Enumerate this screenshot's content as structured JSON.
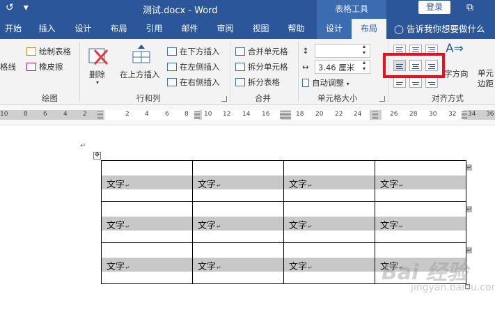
{
  "title_bar": {
    "quick_access": [
      "↺",
      "▾"
    ],
    "document_title": "测试.docx  -  Word",
    "context_tab_title": "表格工具",
    "login_label": "登录",
    "restore_icon": "⧉"
  },
  "tabs": [
    {
      "label": "开始"
    },
    {
      "label": "插入"
    },
    {
      "label": "设计"
    },
    {
      "label": "布局"
    },
    {
      "label": "引用"
    },
    {
      "label": "邮件"
    },
    {
      "label": "审阅"
    },
    {
      "label": "视图"
    },
    {
      "label": "帮助"
    },
    {
      "label": "设计"
    },
    {
      "label": "布局"
    }
  ],
  "tell_me": "告诉我你想要做什么",
  "ribbon": {
    "draw": {
      "partial": "格线",
      "draw_table": "绘制表格",
      "eraser": "橡皮擦",
      "label": "绘图"
    },
    "rows_cols": {
      "delete": "删除",
      "insert_above": "在上方插入",
      "insert_below": "在下方插入",
      "insert_left": "在左侧插入",
      "insert_right": "在右侧插入",
      "label": "行和列"
    },
    "merge": {
      "merge_cells": "合并单元格",
      "split_cells": "拆分单元格",
      "split_table": "拆分表格",
      "label": "合并"
    },
    "cell_size": {
      "height_value": "",
      "width_value": "3.46 厘米",
      "autofit": "自动调整",
      "label": "单元格大小"
    },
    "alignment": {
      "text_direction": "字方向",
      "cell_margins_line1": "单元",
      "cell_margins_line2": "边距",
      "label": "对齐方式"
    }
  },
  "ruler": {
    "left_ticks": [
      "10",
      "8",
      "6",
      "4",
      "2"
    ],
    "right_ticks": [
      "2",
      "4",
      "6",
      "8",
      "10",
      "12",
      "14",
      "16",
      "18",
      "20",
      "22",
      "24",
      "26",
      "28",
      "30",
      "32",
      "34",
      "36"
    ]
  },
  "document": {
    "paragraph_mark": "↵",
    "move_handle": "✥",
    "table": {
      "rows": [
        [
          "文字",
          "文字",
          "文字",
          "文字"
        ],
        [
          "文字",
          "文字",
          "文字",
          "文字"
        ],
        [
          "文字",
          "文字",
          "文字",
          "文字"
        ]
      ]
    },
    "watermark": "Bai 经验",
    "watermark_sub": "jingyan.baidu.com"
  }
}
